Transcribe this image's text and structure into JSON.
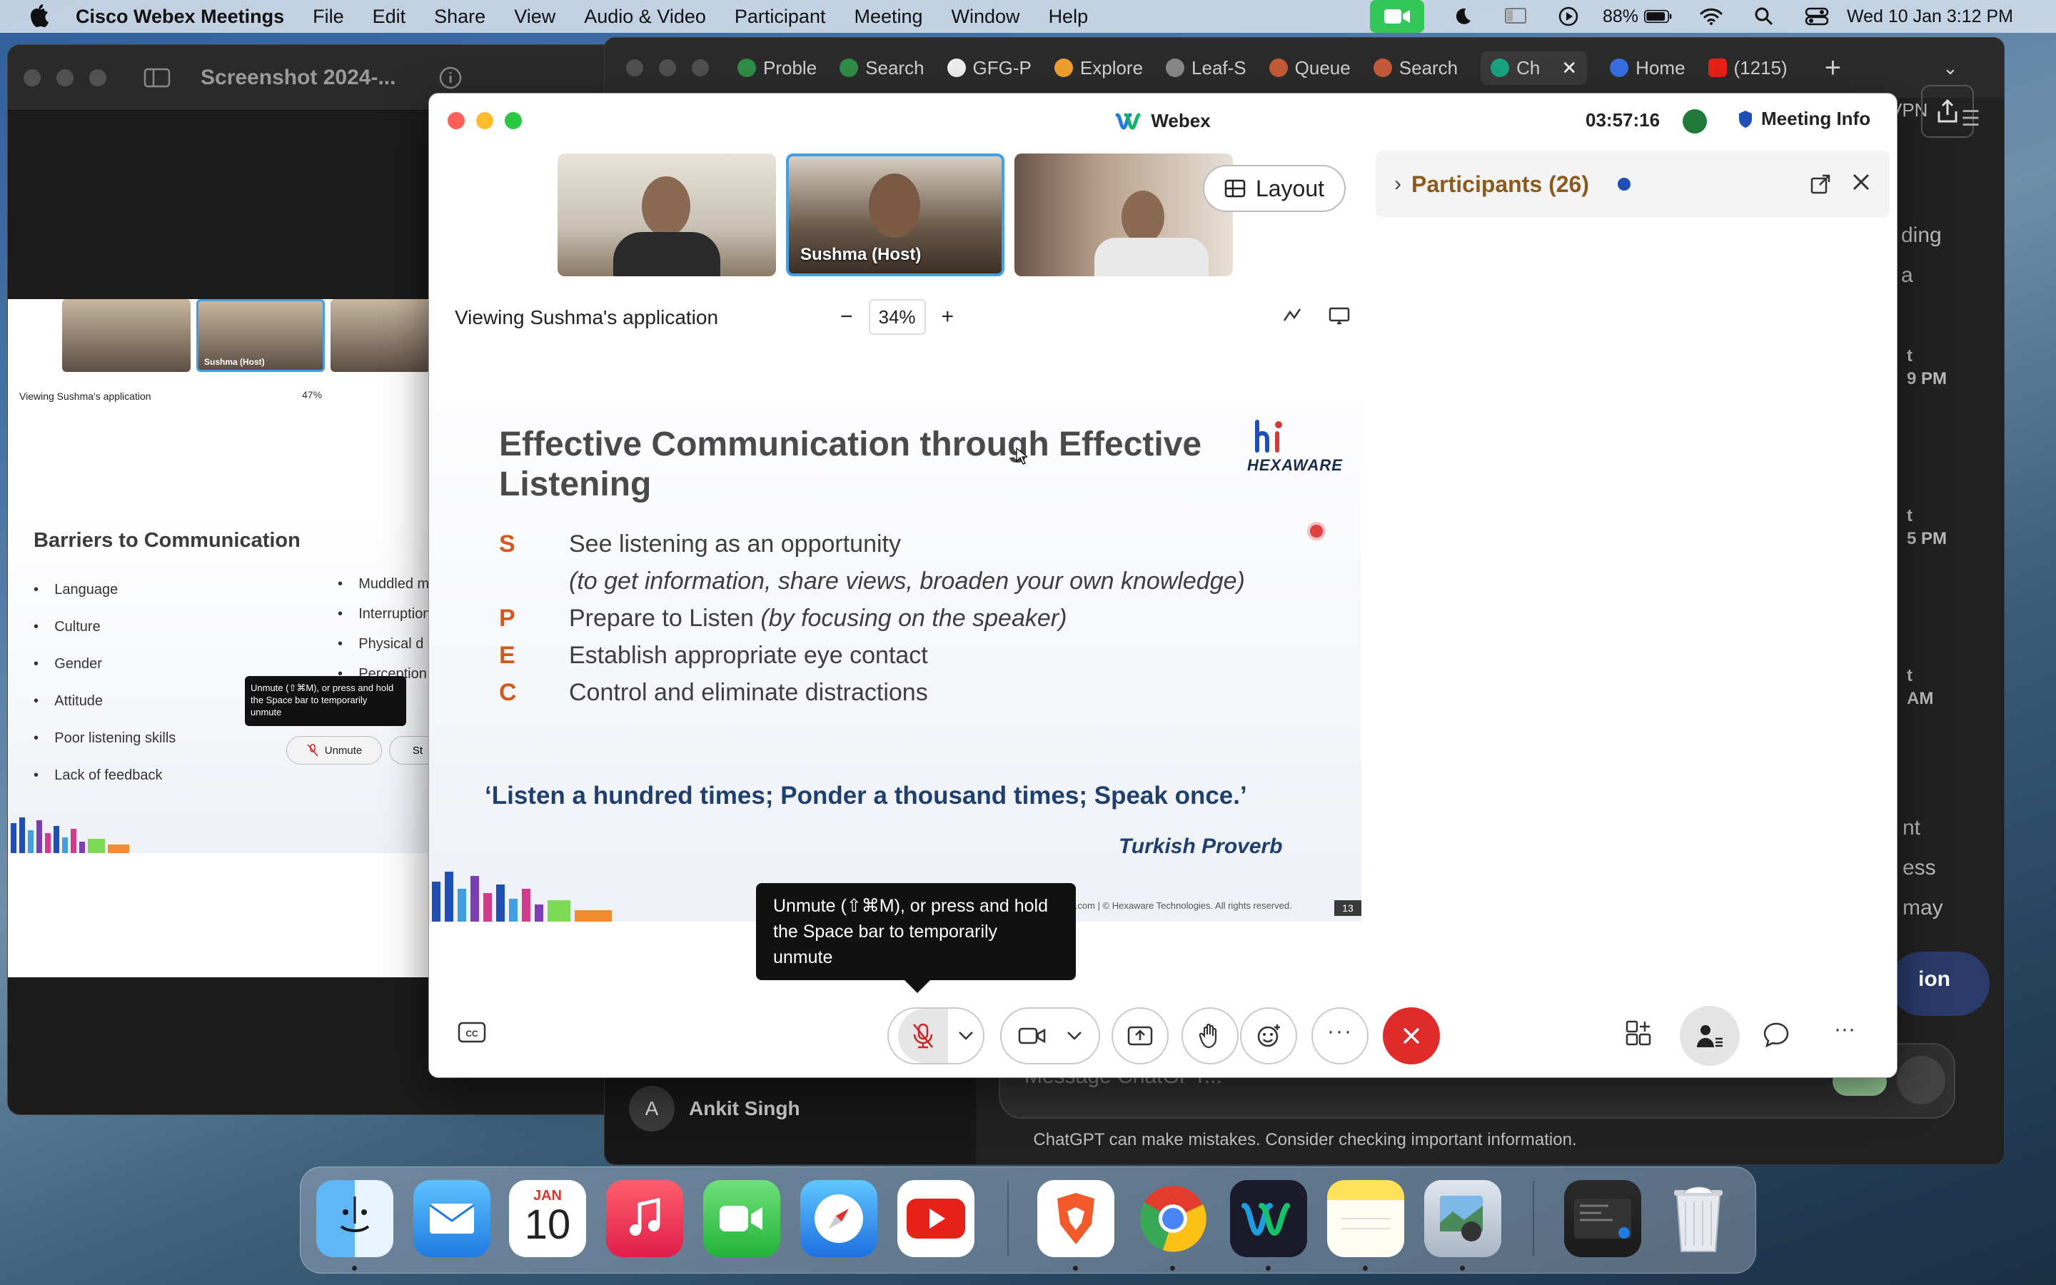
{
  "menubar": {
    "app_name": "Cisco Webex Meetings",
    "menus": [
      "File",
      "Edit",
      "Share",
      "View",
      "Audio & Video",
      "Participant",
      "Meeting",
      "Window",
      "Help"
    ],
    "battery": "88%",
    "datetime": "Wed 10 Jan  3:12 PM"
  },
  "left_window": {
    "title": "Screenshot 2024-...",
    "viewing": "Viewing Sushma's application",
    "zoom": "47%",
    "host_label": "Sushma  (Host)",
    "slide_title": "Barriers to Communication",
    "bullets_left": [
      "Language",
      "Culture",
      "Gender",
      "Attitude",
      "Poor listening skills",
      "Lack of feedback"
    ],
    "bullets_right": [
      "Muddled m",
      "Interruption",
      "Physical d",
      "Perception"
    ],
    "tooltip": "Unmute (⇧⌘M), or press and hold the Space bar to temporarily unmute",
    "unmute_label": "Unmute",
    "stop_label": "St"
  },
  "browser": {
    "tabs": [
      "Proble",
      "Search",
      "GFG-P",
      "Explore",
      "Leaf-S",
      "Queue",
      "Search",
      "Ch",
      "Home",
      "(1215)"
    ],
    "side_fragments": [
      "ding",
      "a",
      "t",
      "9 PM",
      "t",
      "5 PM",
      "t",
      "AM",
      "nt",
      "ess",
      "may",
      "ion",
      "VPN"
    ],
    "sidebar_user": "Ankit Singh",
    "sidebar_avatar": "A",
    "message_placeholder": "Message ChatGPT...",
    "disclaimer": "ChatGPT can make mistakes. Consider checking important information."
  },
  "webex": {
    "title": "Webex",
    "timer": "03:57:16",
    "meeting_info": "Meeting Info",
    "host_label": "Sushma  (Host)",
    "layout_label": "Layout",
    "viewing": "Viewing Sushma's application",
    "zoom": "34%",
    "participants_label": "Participants (26)",
    "tooltip": "Unmute (⇧⌘M), or press and hold the Space bar to temporarily unmute"
  },
  "slide": {
    "title": "Effective Communication through Effective Listening",
    "brand": "HEXAWARE",
    "rows": [
      {
        "letter": "S",
        "text": "See listening as an opportunity",
        "italic": ""
      },
      {
        "letter": "",
        "text": "",
        "italic": "(to get information, share views, broaden your own knowledge)"
      },
      {
        "letter": "P",
        "text": "Prepare to Listen ",
        "italic": "(by focusing on the speaker)"
      },
      {
        "letter": "E",
        "text": "Establish appropriate eye contact",
        "italic": ""
      },
      {
        "letter": "C",
        "text": "Control and eliminate distractions",
        "italic": ""
      }
    ],
    "quote": "‘Listen a hundred times; Ponder a thousand times; Speak once.’",
    "attribution": "Turkish Proverb",
    "footer": "are.com  | © Hexaware Technologies. All rights reserved.",
    "page": "13"
  },
  "dock": {
    "calendar_month": "JAN",
    "calendar_day": "10"
  },
  "colors": {
    "facetime_green": "#33c759",
    "end_call_red": "#e02b2b",
    "slide_letter_orange": "#d45a1c",
    "slide_quote_navy": "#1f3f6e",
    "participants_brown": "#8b5a1c"
  }
}
